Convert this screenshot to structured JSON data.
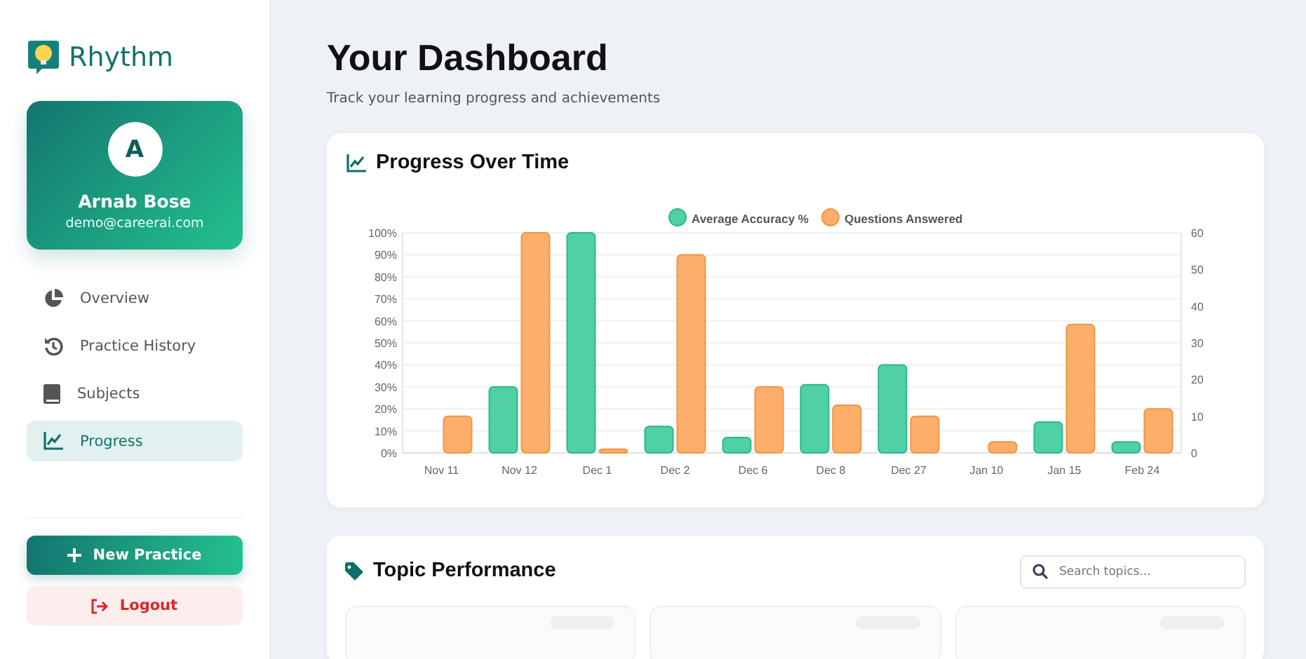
{
  "brand": {
    "name": "Rhythm"
  },
  "profile": {
    "initial": "A",
    "name": "Arnab Bose",
    "email": "demo@careerai.com"
  },
  "nav": [
    {
      "label": "Overview",
      "kind": "pie",
      "selected": false
    },
    {
      "label": "Practice History",
      "kind": "history",
      "selected": false
    },
    {
      "label": "Subjects",
      "kind": "book",
      "selected": false
    },
    {
      "label": "Progress",
      "kind": "chart",
      "selected": true
    }
  ],
  "actions": {
    "new_practice": "New Practice",
    "logout": "Logout"
  },
  "header": {
    "title": "Your Dashboard",
    "subtitle": "Track your learning progress and achievements"
  },
  "progress": {
    "title": "Progress Over Time",
    "chart_data": {
      "type": "bar",
      "categories": [
        "Nov 11",
        "Nov 12",
        "Dec 1",
        "Dec 2",
        "Dec 6",
        "Dec 8",
        "Dec 27",
        "Jan 10",
        "Jan 15",
        "Feb 24"
      ],
      "series": [
        {
          "name": "Average Accuracy %",
          "color": "#4fd1a5",
          "values": [
            0,
            30,
            100,
            12,
            7,
            31,
            40,
            0,
            14,
            5
          ]
        },
        {
          "name": "Questions Answered",
          "color": "#fdae6b",
          "axis": "y2",
          "values": [
            10,
            60,
            1,
            54,
            18,
            13,
            10,
            3,
            35,
            12
          ]
        }
      ],
      "ylim": [
        0,
        100
      ],
      "yticks": [
        {
          "value": 0,
          "label": "0%"
        },
        {
          "value": 10,
          "label": "10%"
        },
        {
          "value": 20,
          "label": "20%"
        },
        {
          "value": 30,
          "label": "30%"
        },
        {
          "value": 40,
          "label": "40%"
        },
        {
          "value": 50,
          "label": "50%"
        },
        {
          "value": 60,
          "label": "60%"
        },
        {
          "value": 70,
          "label": "70%"
        },
        {
          "value": 80,
          "label": "80%"
        },
        {
          "value": 90,
          "label": "90%"
        },
        {
          "value": 100,
          "label": "100%"
        }
      ],
      "grid": true,
      "legend": "top",
      "y2lim": [
        0,
        60
      ],
      "y2ticks": [
        0,
        10,
        20,
        30,
        40,
        50,
        60
      ]
    }
  },
  "topics": {
    "title": "Topic Performance",
    "search": {
      "placeholder": "Search topics..."
    },
    "cards": [
      {
        "kind": "topic"
      },
      {
        "kind": "topic"
      },
      {
        "kind": "topic"
      }
    ]
  }
}
